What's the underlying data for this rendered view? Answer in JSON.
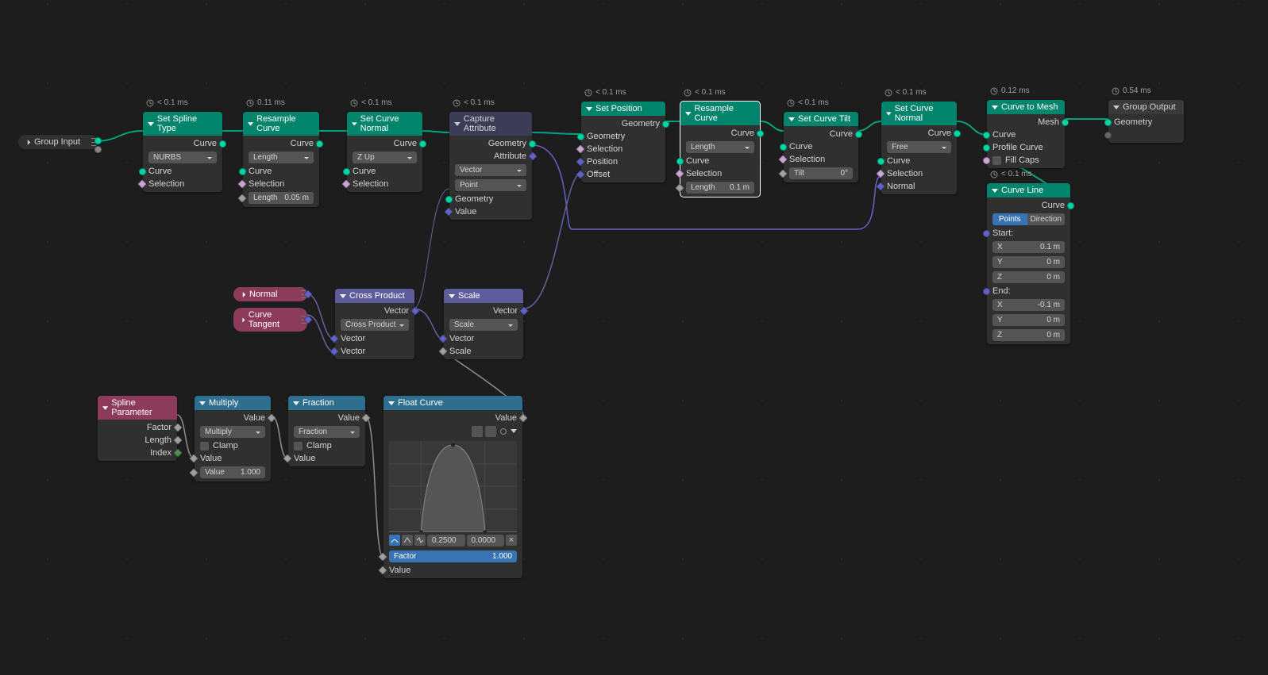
{
  "timings": {
    "set_spline_type": "< 0.1 ms",
    "resample_curve_1": "0.11 ms",
    "set_curve_normal_1": "< 0.1 ms",
    "capture_attribute": "< 0.1 ms",
    "set_position": "< 0.1 ms",
    "resample_curve_2": "< 0.1 ms",
    "set_curve_tilt": "< 0.1 ms",
    "set_curve_normal_2": "< 0.1 ms",
    "curve_to_mesh": "0.12 ms",
    "group_output": "0.54 ms",
    "curve_line": "< 0.1 ms"
  },
  "group_input": {
    "title": "Group Input"
  },
  "set_spline_type": {
    "title": "Set Spline Type",
    "out_curve": "Curve",
    "type_value": "NURBS",
    "in_curve": "Curve",
    "in_selection": "Selection"
  },
  "resample_curve_1": {
    "title": "Resample Curve",
    "out_curve": "Curve",
    "mode": "Length",
    "in_curve": "Curve",
    "in_selection": "Selection",
    "length_label": "Length",
    "length_value": "0.05 m"
  },
  "set_curve_normal_1": {
    "title": "Set Curve Normal",
    "out_curve": "Curve",
    "mode": "Z Up",
    "in_curve": "Curve",
    "in_selection": "Selection"
  },
  "capture_attribute": {
    "title": "Capture Attribute",
    "out_geometry": "Geometry",
    "out_attribute": "Attribute",
    "type": "Vector",
    "domain": "Point",
    "in_geometry": "Geometry",
    "in_value": "Value"
  },
  "set_position": {
    "title": "Set Position",
    "out_geometry": "Geometry",
    "in_geometry": "Geometry",
    "in_selection": "Selection",
    "in_position": "Position",
    "in_offset": "Offset"
  },
  "resample_curve_2": {
    "title": "Resample Curve",
    "out_curve": "Curve",
    "mode": "Length",
    "in_curve": "Curve",
    "in_selection": "Selection",
    "length_label": "Length",
    "length_value": "0.1 m"
  },
  "set_curve_tilt": {
    "title": "Set Curve Tilt",
    "out_curve": "Curve",
    "in_curve": "Curve",
    "in_selection": "Selection",
    "tilt_label": "Tilt",
    "tilt_value": "0°"
  },
  "set_curve_normal_2": {
    "title": "Set Curve Normal",
    "out_curve": "Curve",
    "mode": "Free",
    "in_curve": "Curve",
    "in_selection": "Selection",
    "in_normal": "Normal"
  },
  "curve_to_mesh": {
    "title": "Curve to Mesh",
    "out_mesh": "Mesh",
    "in_curve": "Curve",
    "in_profile": "Profile Curve",
    "in_fillcaps": "Fill Caps"
  },
  "group_output": {
    "title": "Group Output",
    "in_geometry": "Geometry"
  },
  "curve_line": {
    "title": "Curve Line",
    "out_curve": "Curve",
    "btn_points": "Points",
    "btn_direction": "Direction",
    "start_label": "Start:",
    "sx_l": "X",
    "sx_v": "0.1 m",
    "sy_l": "Y",
    "sy_v": "0 m",
    "sz_l": "Z",
    "sz_v": "0 m",
    "end_label": "End:",
    "ex_l": "X",
    "ex_v": "-0.1 m",
    "ey_l": "Y",
    "ey_v": "0 m",
    "ez_l": "Z",
    "ez_v": "0 m"
  },
  "normal_pill": {
    "title": "Normal"
  },
  "tangent_pill": {
    "title": "Curve Tangent"
  },
  "cross_product": {
    "title": "Cross Product",
    "out_vector": "Vector",
    "op": "Cross Product",
    "in_vector_a": "Vector",
    "in_vector_b": "Vector"
  },
  "scale": {
    "title": "Scale",
    "out_vector": "Vector",
    "op": "Scale",
    "in_vector": "Vector",
    "in_scale": "Scale"
  },
  "spline_parameter": {
    "title": "Spline Parameter",
    "out_factor": "Factor",
    "out_length": "Length",
    "out_index": "Index"
  },
  "multiply": {
    "title": "Multiply",
    "out_value": "Value",
    "op": "Multiply",
    "clamp": "Clamp",
    "in_value": "Value",
    "val_label": "Value",
    "val_value": "1.000"
  },
  "fraction": {
    "title": "Fraction",
    "out_value": "Value",
    "op": "Fraction",
    "clamp": "Clamp",
    "in_value": "Value"
  },
  "float_curve": {
    "title": "Float Curve",
    "out_value": "Value",
    "handle_x": "0.2500",
    "handle_y": "0.0000",
    "factor_label": "Factor",
    "factor_value": "1.000",
    "in_value": "Value"
  }
}
